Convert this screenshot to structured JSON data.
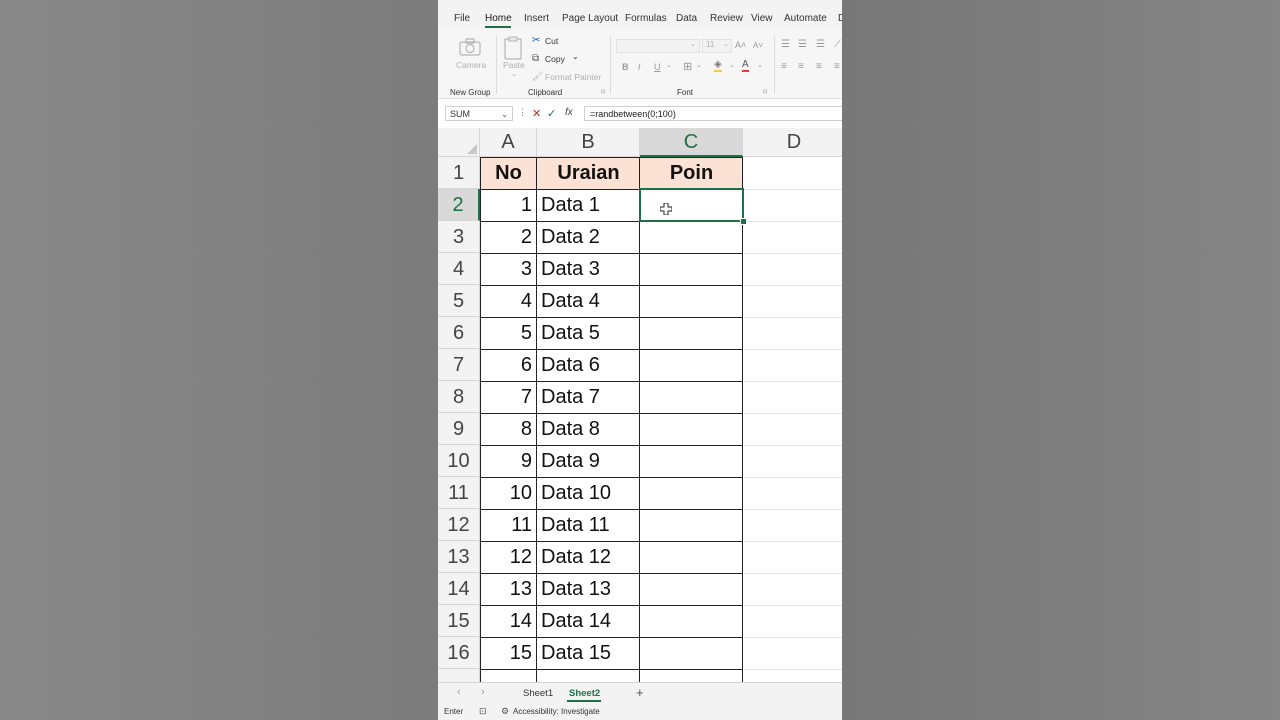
{
  "ribbon_tabs": [
    "File",
    "Home",
    "Insert",
    "Page Layout",
    "Formulas",
    "Data",
    "Review",
    "View",
    "Automate",
    "D"
  ],
  "active_tab": "Home",
  "ribbon": {
    "camera_label": "Camera",
    "new_group_label": "New Group",
    "paste_label": "Paste",
    "cut_label": "Cut",
    "copy_label": "Copy",
    "format_painter_label": "Format Painter",
    "clipboard_group": "Clipboard",
    "font_group": "Font",
    "font_size": "11",
    "bold_label": "B",
    "italic_label": "I",
    "underline_label": "U"
  },
  "formula_bar": {
    "name_box": "SUM",
    "formula": "=randbetween(0;100)",
    "cancel_icon": "close-icon",
    "enter_icon": "check-icon",
    "fx_label": "fx"
  },
  "columns": [
    "A",
    "B",
    "C",
    "D"
  ],
  "rows": [
    "1",
    "2",
    "3",
    "4",
    "5",
    "6",
    "7",
    "8",
    "9",
    "10",
    "11",
    "12",
    "13",
    "14",
    "15",
    "16"
  ],
  "table": {
    "headers": [
      "No",
      "Uraian",
      "Poin"
    ],
    "rows": [
      [
        "1",
        "Data 1",
        ""
      ],
      [
        "2",
        "Data 2",
        ""
      ],
      [
        "3",
        "Data 3",
        ""
      ],
      [
        "4",
        "Data 4",
        ""
      ],
      [
        "5",
        "Data 5",
        ""
      ],
      [
        "6",
        "Data 6",
        ""
      ],
      [
        "7",
        "Data 7",
        ""
      ],
      [
        "8",
        "Data 8",
        ""
      ],
      [
        "9",
        "Data 9",
        ""
      ],
      [
        "10",
        "Data 10",
        ""
      ],
      [
        "11",
        "Data 11",
        ""
      ],
      [
        "12",
        "Data 12",
        ""
      ],
      [
        "13",
        "Data 13",
        ""
      ],
      [
        "14",
        "Data 14",
        ""
      ],
      [
        "15",
        "Data 15",
        ""
      ]
    ]
  },
  "active_cell": "C2",
  "sheets": [
    "Sheet1",
    "Sheet2"
  ],
  "active_sheet": "Sheet2",
  "status": {
    "mode": "Enter",
    "accessibility": "Accessibility: Investigate"
  },
  "colors": {
    "accent": "#1e7145",
    "header_fill": "#fbe2d5"
  }
}
